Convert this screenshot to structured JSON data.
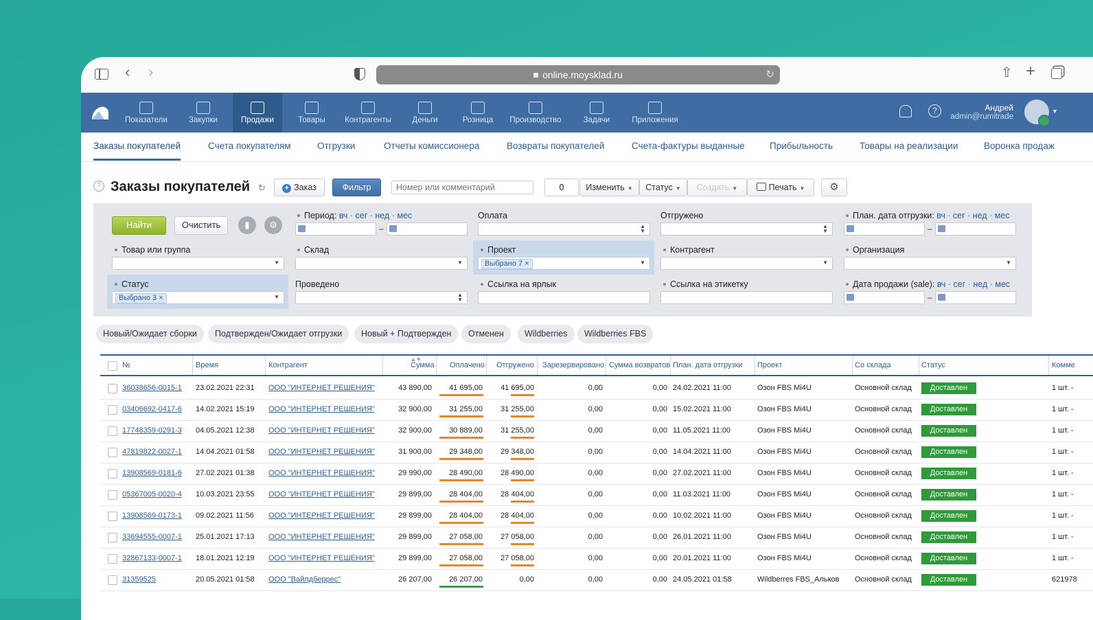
{
  "browser": {
    "url": "online.moysklad.ru"
  },
  "topnav": {
    "items": [
      {
        "label": "Показатели"
      },
      {
        "label": "Закупки"
      },
      {
        "label": "Продажи"
      },
      {
        "label": "Товары"
      },
      {
        "label": "Контрагенты"
      },
      {
        "label": "Деньги"
      },
      {
        "label": "Розница"
      },
      {
        "label": "Производство"
      },
      {
        "label": "Задачи"
      },
      {
        "label": "Приложения"
      }
    ],
    "user": {
      "name": "Андрей",
      "login": "admin@rumitrade"
    }
  },
  "subnav": {
    "items": [
      {
        "label": "Заказы покупателей"
      },
      {
        "label": "Счета покупателям"
      },
      {
        "label": "Отгрузки"
      },
      {
        "label": "Отчеты комиссионера"
      },
      {
        "label": "Возвраты покупателей"
      },
      {
        "label": "Счета-фактуры выданные"
      },
      {
        "label": "Прибыльность"
      },
      {
        "label": "Товары на реализации"
      },
      {
        "label": "Воронка продаж"
      }
    ]
  },
  "page": {
    "title": "Заказы покупателей",
    "order_btn": "Заказ",
    "filter_btn": "Фильтр",
    "search_placeholder": "Номер или комментарий",
    "selected_count": "0",
    "change_btn": "Изменить",
    "status_btn": "Статус",
    "create_btn": "Создать",
    "print_btn": "Печать"
  },
  "filter": {
    "find_btn": "Найти",
    "clear_btn": "Очистить",
    "period": "Период:",
    "period_links": "вч · сег · нед · мес",
    "payment": "Оплата",
    "shipped": "Отгружено",
    "plan_date": "План. дата отгрузки:",
    "product": "Товар или группа",
    "warehouse": "Склад",
    "project": "Проект",
    "project_tag": "Выбрано 7 ×",
    "counterparty": "Контрагент",
    "organization": "Организация",
    "status": "Статус",
    "status_tag": "Выбрано 3 ×",
    "posted": "Проведено",
    "label_link": "Ссылка на ярлык",
    "sticker_link": "Ссылка на этикетку",
    "sale_date": "Дата продажи (sale):"
  },
  "chips": [
    "Новый/Ожидает сборки",
    "Подтвержден/Ожидает отгрузки",
    "Новый + Подтвержден",
    "Отменен",
    "Wildberries",
    "Wildberries FBS"
  ],
  "table": {
    "headers": [
      "№",
      "Время",
      "Контрагент",
      "Сумма",
      "Оплачено",
      "Отгружено",
      "Зарезервировано",
      "Сумма возвратов",
      "План. дата отгрузки",
      "Проект",
      "Со склада",
      "Статус",
      "Комме"
    ],
    "rows": [
      {
        "num": "36038656-0015-1",
        "time": "23.02.2021 22:31",
        "cp": "ООО \"ИНТЕРНЕТ РЕШЕНИЯ\"",
        "sum": "43 890,00",
        "paid": "41 695,00",
        "shipped": "41 695,00",
        "reserved": "0,00",
        "returns": "0,00",
        "plan": "24.02.2021 11:00",
        "project": "Озон FBS Mi4U",
        "wh": "Основной склад",
        "status": "Доставлен",
        "comment": "1 шт. -"
      },
      {
        "num": "03406692-0417-6",
        "time": "14.02.2021 15:19",
        "cp": "ООО \"ИНТЕРНЕТ РЕШЕНИЯ\"",
        "sum": "32 900,00",
        "paid": "31 255,00",
        "shipped": "31 255,00",
        "reserved": "0,00",
        "returns": "0,00",
        "plan": "15.02.2021 11:00",
        "project": "Озон FBS Mi4U",
        "wh": "Основной склад",
        "status": "Доставлен",
        "comment": "1 шт. -"
      },
      {
        "num": "17748359-0291-3",
        "time": "04.05.2021 12:38",
        "cp": "ООО \"ИНТЕРНЕТ РЕШЕНИЯ\"",
        "sum": "32 900,00",
        "paid": "30 889,00",
        "shipped": "31 255,00",
        "reserved": "0,00",
        "returns": "0,00",
        "plan": "11.05.2021 11:00",
        "project": "Озон FBS Mi4U",
        "wh": "Основной склад",
        "status": "Доставлен",
        "comment": "1 шт. -"
      },
      {
        "num": "47819822-0027-1",
        "time": "14.04.2021 01:58",
        "cp": "ООО \"ИНТЕРНЕТ РЕШЕНИЯ\"",
        "sum": "31 900,00",
        "paid": "29 348,00",
        "shipped": "29 348,00",
        "reserved": "0,00",
        "returns": "0,00",
        "plan": "14.04.2021 11:00",
        "project": "Озон FBS Mi4U",
        "wh": "Основной склад",
        "status": "Доставлен",
        "comment": "1 шт. -"
      },
      {
        "num": "13908569-0181-6",
        "time": "27.02.2021 01:38",
        "cp": "ООО \"ИНТЕРНЕТ РЕШЕНИЯ\"",
        "sum": "29 990,00",
        "paid": "28 490,00",
        "shipped": "28 490,00",
        "reserved": "0,00",
        "returns": "0,00",
        "plan": "27.02.2021 11:00",
        "project": "Озон FBS Mi4U",
        "wh": "Основной склад",
        "status": "Доставлен",
        "comment": "1 шт. -"
      },
      {
        "num": "05367005-0020-4",
        "time": "10.03.2021 23:55",
        "cp": "ООО \"ИНТЕРНЕТ РЕШЕНИЯ\"",
        "sum": "29 899,00",
        "paid": "28 404,00",
        "shipped": "28 404,00",
        "reserved": "0,00",
        "returns": "0,00",
        "plan": "11.03.2021 11:00",
        "project": "Озон FBS Mi4U",
        "wh": "Основной склад",
        "status": "Доставлен",
        "comment": "1 шт. -"
      },
      {
        "num": "13908569-0173-1",
        "time": "09.02.2021 11:56",
        "cp": "ООО \"ИНТЕРНЕТ РЕШЕНИЯ\"",
        "sum": "29 899,00",
        "paid": "28 404,00",
        "shipped": "28 404,00",
        "reserved": "0,00",
        "returns": "0,00",
        "plan": "10.02.2021 11:00",
        "project": "Озон FBS Mi4U",
        "wh": "Основной склад",
        "status": "Доставлен",
        "comment": "1 шт. -"
      },
      {
        "num": "33694555-0007-1",
        "time": "25.01.2021 17:13",
        "cp": "ООО \"ИНТЕРНЕТ РЕШЕНИЯ\"",
        "sum": "29 899,00",
        "paid": "27 058,00",
        "shipped": "27 058,00",
        "reserved": "0,00",
        "returns": "0,00",
        "plan": "26.01.2021 11:00",
        "project": "Озон FBS Mi4U",
        "wh": "Основной склад",
        "status": "Доставлен",
        "comment": "1 шт. -"
      },
      {
        "num": "32867133-0007-1",
        "time": "18.01.2021 12:19",
        "cp": "ООО \"ИНТЕРНЕТ РЕШЕНИЯ\"",
        "sum": "29 899,00",
        "paid": "27 058,00",
        "shipped": "27 058,00",
        "reserved": "0,00",
        "returns": "0,00",
        "plan": "20.01.2021 11:00",
        "project": "Озон FBS Mi4U",
        "wh": "Основной склад",
        "status": "Доставлен",
        "comment": "1 шт. -"
      },
      {
        "num": "31359525",
        "time": "20.05.2021 01:58",
        "cp": "ООО \"Вайлдберрес\"",
        "sum": "26 207,00",
        "paid": "26 207,00",
        "shipped": "0,00",
        "reserved": "0,00",
        "returns": "0,00",
        "plan": "24.05.2021 01:58",
        "project": "Wildberres FBS_Альков",
        "wh": "Основной склад",
        "status": "Доставлен",
        "comment": "621978"
      }
    ]
  }
}
